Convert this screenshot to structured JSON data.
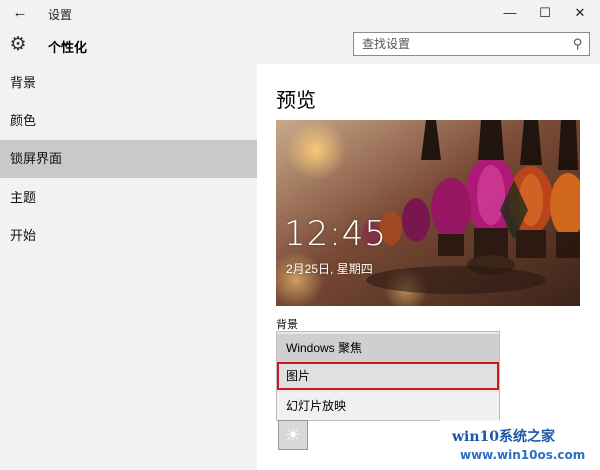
{
  "window": {
    "title": "设置",
    "back_icon": "←",
    "minimize_icon": "—",
    "maximize_icon": "☐",
    "close_icon": "✕"
  },
  "header": {
    "gear_icon": "⚙",
    "title": "个性化",
    "search_placeholder": "查找设置",
    "search_icon": "⚲"
  },
  "sidebar": {
    "items": [
      {
        "label": "背景",
        "selected": false
      },
      {
        "label": "颜色",
        "selected": false
      },
      {
        "label": "锁屏界面",
        "selected": true
      },
      {
        "label": "主题",
        "selected": false
      },
      {
        "label": "开始",
        "selected": false
      }
    ]
  },
  "main": {
    "title": "预览",
    "preview": {
      "time": "12:45",
      "date": "2月25日, 星期四"
    },
    "background_label": "背景",
    "dropdown_options": [
      {
        "label": "Windows 聚焦"
      },
      {
        "label": "图片",
        "highlighted": true
      },
      {
        "label": "幻灯片放映"
      }
    ],
    "thumb_icon": "☀"
  },
  "watermark": {
    "line1": "win10系统之家",
    "line2": "www.win10os.com"
  },
  "colors": {
    "sidebar_bg": "#f2f2f2",
    "selected_bg": "#c9c9c9",
    "highlight_border": "#d2151d",
    "watermark_blue": "#1e57a8"
  }
}
